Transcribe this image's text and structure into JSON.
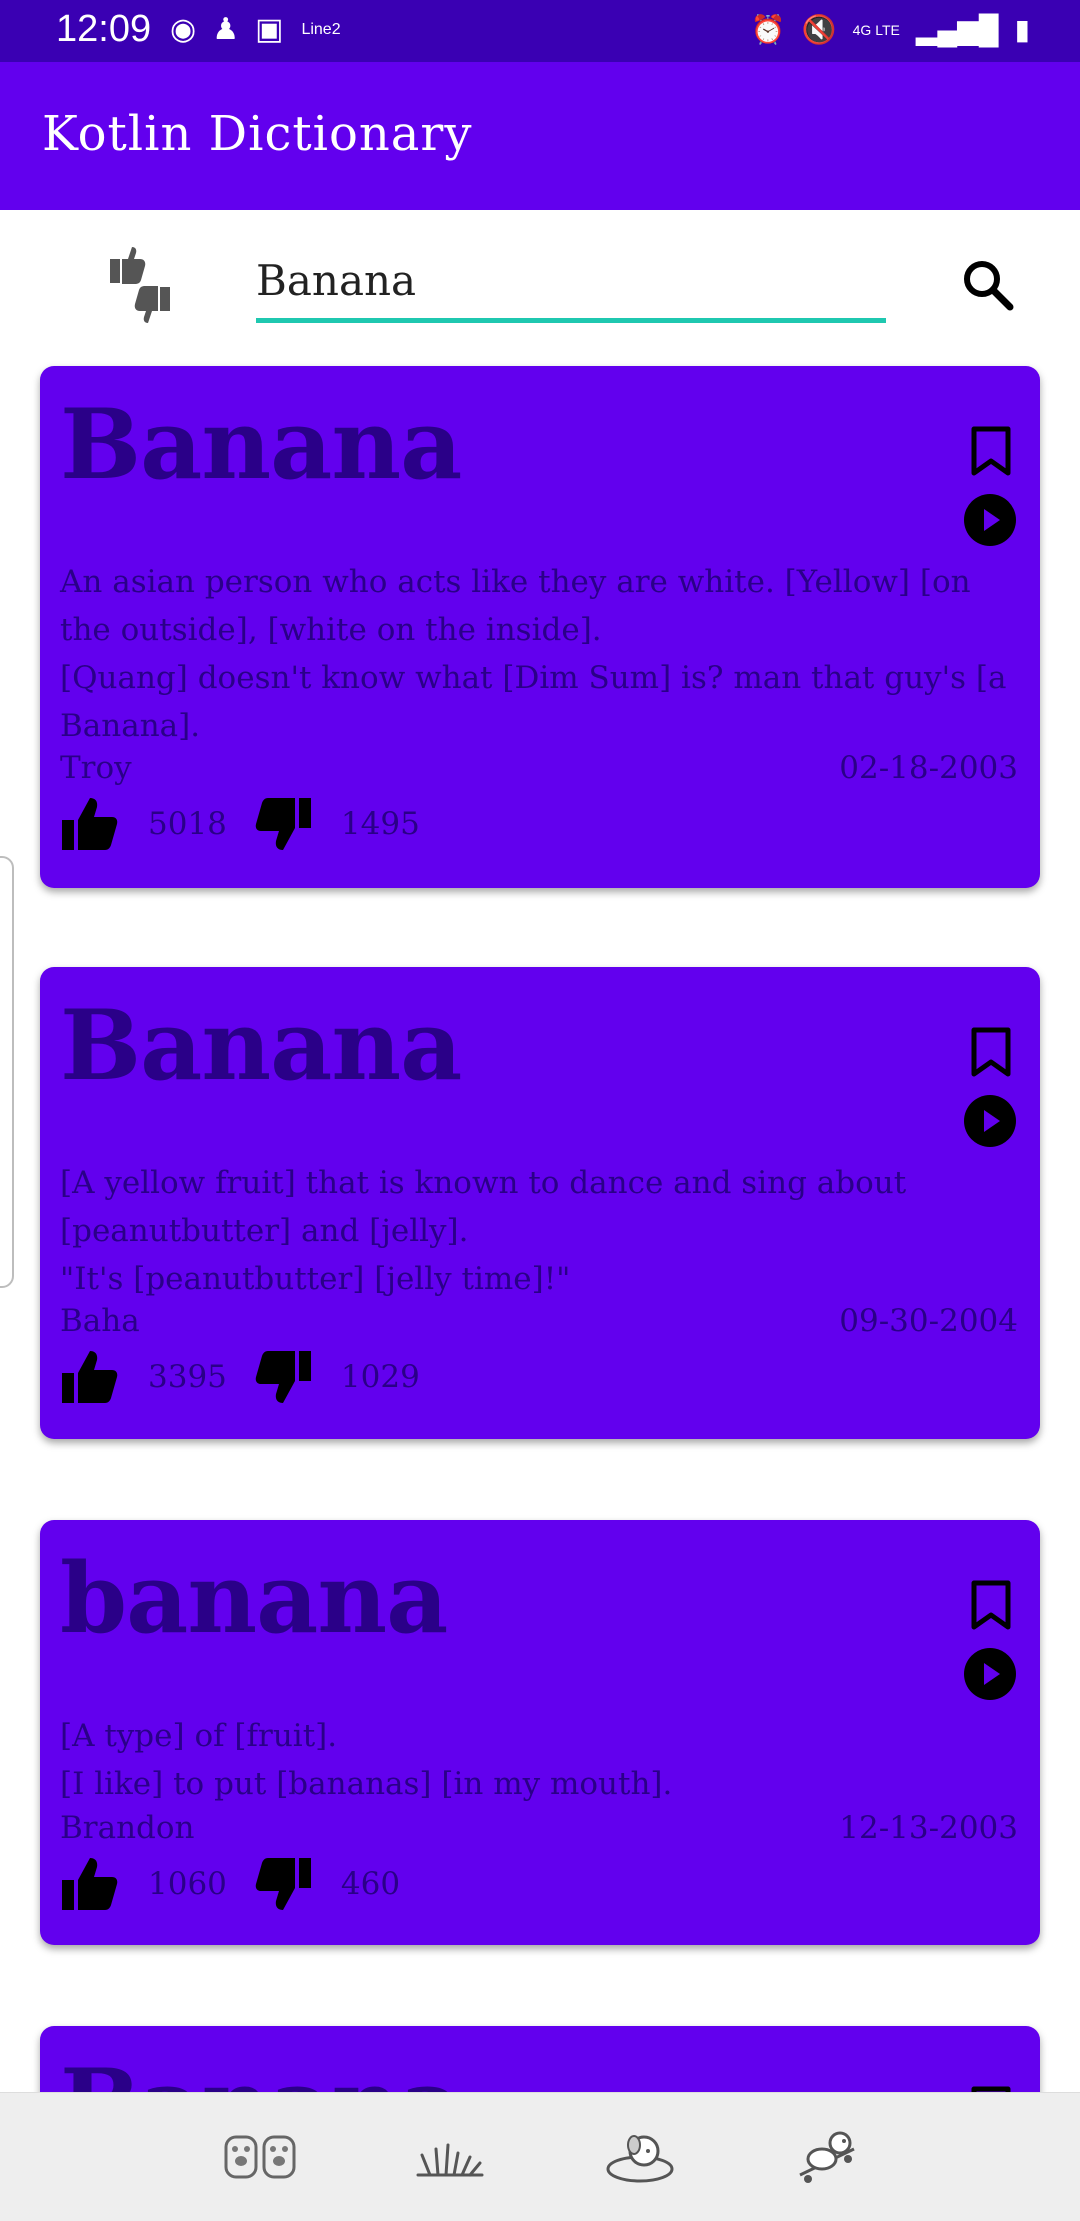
{
  "status_bar": {
    "time": "12:09",
    "carrier_label": "Line2",
    "left_icons": [
      "face-id-icon",
      "android-icon",
      "image-icon"
    ],
    "right_icons": [
      "alarm-icon",
      "mute-icon",
      "network-4g-lte-icon",
      "signal-icon",
      "battery-charging-icon"
    ],
    "network_text": "4G LTE"
  },
  "app_bar": {
    "title": "Kotlin Dictionary",
    "color": "#6200ee"
  },
  "search": {
    "value": "Banana",
    "underline_color": "#1fc8b0"
  },
  "cards": [
    {
      "word": "Banana",
      "definition_lines": [
        "An asian person who acts like they are white. [Yellow] [on the outside], [white on the inside].",
        "[Quang] doesn't know what [Dim Sum] is? man that guy's [a Banana]."
      ],
      "author": "Troy",
      "date": "02-18-2003",
      "thumbs_up": "5018",
      "thumbs_down": "1495"
    },
    {
      "word": "Banana",
      "definition_lines": [
        "[A yellow fruit] that is known to dance and sing about [peanutbutter] and [jelly].",
        "\"It's [peanutbutter] [jelly time]!\""
      ],
      "author": "Baha",
      "date": "09-30-2004",
      "thumbs_up": "3395",
      "thumbs_down": "1029"
    },
    {
      "word": "banana",
      "definition_lines": [
        "[A type] of [fruit].",
        "[I like] to put [bananas] [in my mouth]."
      ],
      "author": "Brandon",
      "date": "12-13-2003",
      "thumbs_up": "1060",
      "thumbs_down": "460"
    },
    {
      "word": "Banana"
    }
  ],
  "bottom_nav": {
    "items": [
      "paws-icon",
      "grass-icon",
      "dog-in-bed-icon",
      "dog-skateboard-icon"
    ]
  }
}
